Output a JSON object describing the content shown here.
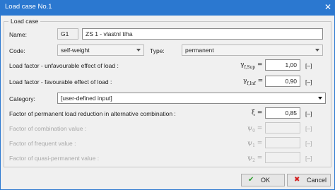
{
  "window": {
    "title": "Load case No.1",
    "close_glyph": "✕"
  },
  "group": {
    "legend": "Load case"
  },
  "name": {
    "label": "Name:",
    "code": "G1",
    "value": "ZS 1 - vlastní tíha"
  },
  "code": {
    "label": "Code:",
    "value": "self-weight"
  },
  "type": {
    "label": "Type:",
    "value": "permanent"
  },
  "factors": {
    "unfav": {
      "label": "Load factor - unfavourable effect of load :",
      "symbol": "γ",
      "sub": "f,Sup",
      "eq": "=",
      "value": "1,00",
      "unit": "[–]"
    },
    "fav": {
      "label": "Load factor - favourable effect of load :",
      "symbol": "γ",
      "sub": "f,Inf",
      "eq": "=",
      "value": "0,90",
      "unit": "[–]"
    }
  },
  "category": {
    "label": "Category:",
    "value": "[user-defined input]"
  },
  "reduction": {
    "label": "Factor of permanent load reduction in alternative combination :",
    "symbol": "ξ",
    "eq": "=",
    "value": "0,85",
    "unit": "[–]"
  },
  "combination": {
    "label": "Factor of combination value :",
    "symbol": "ψ",
    "sub": "0",
    "eq": "=",
    "value": "",
    "unit": "[–]"
  },
  "frequent": {
    "label": "Factor of frequent value :",
    "symbol": "ψ",
    "sub": "1",
    "eq": "=",
    "value": "",
    "unit": "[–]"
  },
  "quasi": {
    "label": "Factor of quasi-permanent value :",
    "symbol": "ψ",
    "sub": "2",
    "eq": "=",
    "value": "",
    "unit": "[–]"
  },
  "buttons": {
    "ok": {
      "label": "OK",
      "icon": "✔"
    },
    "cancel": {
      "label": "Cancel",
      "icon": "✖"
    }
  },
  "colors": {
    "titlebar": "#2b78d0",
    "ok_icon": "#2a9d2a",
    "cancel_icon": "#d32020"
  }
}
